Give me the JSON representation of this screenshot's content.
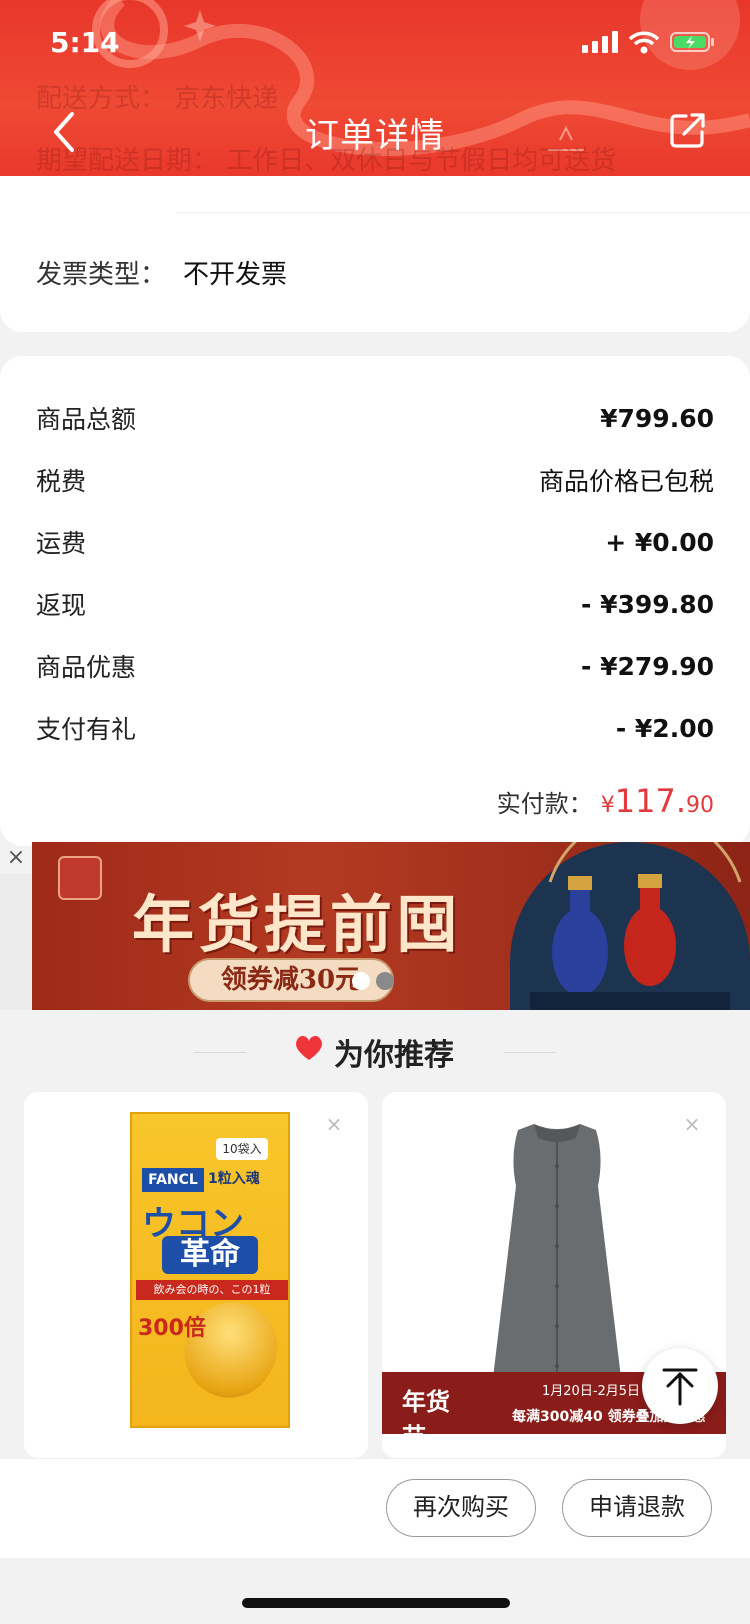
{
  "status_bar": {
    "time": "5:14"
  },
  "header": {
    "title": "订单详情",
    "ghost_line_1": "配送方式：    京东快递",
    "ghost_line_2": "期望配送日期：   工作日、双休日与节假日均可送货"
  },
  "invoice": {
    "label": "发票类型：",
    "value": "不开发票"
  },
  "summary": {
    "rows": [
      {
        "label": "商品总额",
        "value": "¥799.60"
      },
      {
        "label": "税费",
        "value": "商品价格已包税"
      },
      {
        "label": "运费",
        "value": "+ ¥0.00"
      },
      {
        "label": "返现",
        "value": "- ¥399.80"
      },
      {
        "label": "商品优惠",
        "value": "- ¥279.90"
      },
      {
        "label": "支付有礼",
        "value": "- ¥2.00"
      }
    ],
    "total_label": "实付款：",
    "total_currency": "¥",
    "total_integer": "117.",
    "total_decimal": "90"
  },
  "banner": {
    "close_label": "×",
    "headline": "年货提前囤",
    "pill_text": "领券减30元",
    "accent_color": "#a8301c",
    "carousel_count": 2,
    "carousel_active_index": 0
  },
  "recommend": {
    "title": "为你推荐",
    "products": [
      {
        "close": "×",
        "badge": "10袋入",
        "brand": "FANCL",
        "tag": "1粒入魂",
        "title_1": "ウコン",
        "title_2": "革命",
        "strip": "飲み会の時の、この1粒",
        "multiplier": "300倍"
      },
      {
        "close": "×",
        "promo_logo": "年货节",
        "promo_date": "1月20日-2月5日",
        "promo_text": "每满300减40 领券叠加更优惠"
      }
    ]
  },
  "actions": {
    "rebuy": "再次购买",
    "refund": "申请退款"
  },
  "colors": {
    "header_red": "#e8362b",
    "price_red": "#e4393c"
  }
}
